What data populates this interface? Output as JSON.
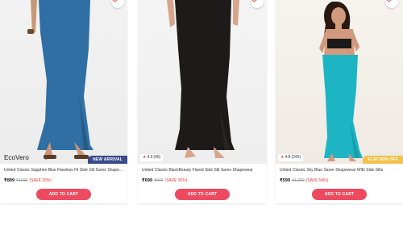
{
  "products": [
    {
      "title": "United Classic Sapphire Blue Flawless Fit Side Slit Saree Shape...",
      "price": "₹899",
      "mrp": "₹1599",
      "save": "(SAVE 20%)",
      "badge": "NEW ARRIVAL",
      "brand_logo": "EcoVero",
      "cta": "ADD TO CART",
      "garment_color": "#2f6fa3",
      "skin_color": "#c99778",
      "hair_color": "#2a1b14"
    },
    {
      "title": "United Classic BlackBeauty Flared Side Slit Saree Shapewear",
      "price": "₹699",
      "mrp": "₹999",
      "save": "(SAVE 30%)",
      "rating": "4.9",
      "rating_count": "(45)",
      "cta": "ADD TO CART",
      "garment_color": "#1e1a19",
      "skin_color": "#d7a58b",
      "hair_color": "#1a120d"
    },
    {
      "title": "United Classic Sky Blue Saree Shapewear With Side Slits",
      "price": "₹599",
      "mrp": "₹1,299",
      "save": "(SAVE 54%)",
      "rating": "4.8",
      "rating_count": "(249)",
      "badge": "FLAT 60% OFF",
      "cta": "ADD TO CART",
      "garment_color": "#1db4c3",
      "skin_color": "#d29a7d",
      "hair_color": "#2a1812"
    }
  ],
  "accent_color": "#ee4a5f"
}
